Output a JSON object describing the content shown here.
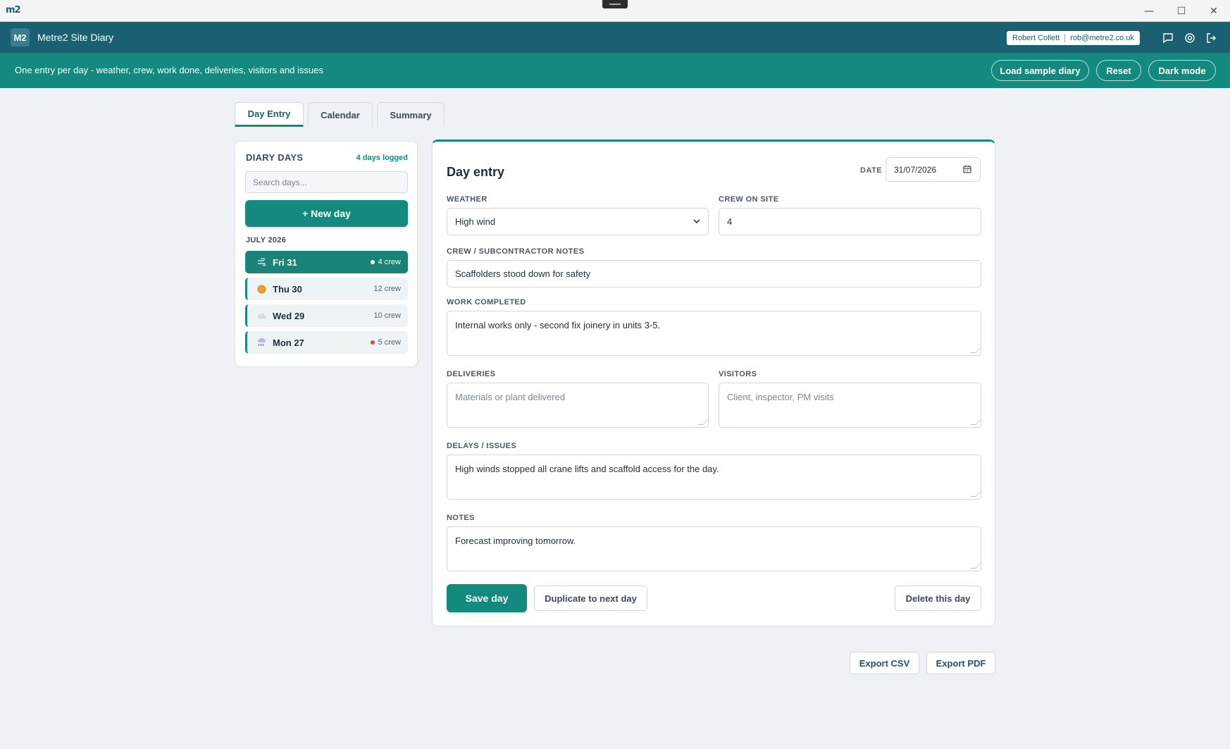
{
  "window": {
    "logo": "m2",
    "minimize_glyph": "—",
    "maximize_glyph": "☐",
    "close_glyph": "✕"
  },
  "header": {
    "badge": "M2",
    "title": "Metre2 Site Diary",
    "user_name": "Robert Collett",
    "user_email": "rob@metre2.co.uk",
    "icons": [
      "chat-icon",
      "gear-icon",
      "logout-icon"
    ]
  },
  "banner": {
    "tagline": "One entry per day - weather, crew, work done, deliveries, visitors and issues",
    "load_sample": "Load sample diary",
    "reset": "Reset",
    "dark_mode": "Dark mode"
  },
  "tabs": [
    {
      "label": "Day Entry",
      "active": true
    },
    {
      "label": "Calendar",
      "active": false
    },
    {
      "label": "Summary",
      "active": false
    }
  ],
  "sidebar": {
    "title": "DIARY DAYS",
    "count": "4 days logged",
    "search_placeholder": "Search days...",
    "new_day": "+ New day",
    "month": "JULY 2026",
    "days": [
      {
        "label": "Fri 31",
        "crew": "4 crew",
        "weather_icon": "wind-icon",
        "dot_color": "#ffffff",
        "active": true
      },
      {
        "label": "Thu 30",
        "crew": "12 crew",
        "weather_icon": "sun-icon",
        "dot_color": "",
        "active": false
      },
      {
        "label": "Wed 29",
        "crew": "10 crew",
        "weather_icon": "cloud-icon",
        "dot_color": "",
        "active": false
      },
      {
        "label": "Mon 27",
        "crew": "5 crew",
        "weather_icon": "rain-icon",
        "dot_color": "#d9463b",
        "active": false
      }
    ]
  },
  "entry": {
    "title": "Day entry",
    "date_label": "DATE",
    "date_value": "31/07/2026",
    "weather_label": "WEATHER",
    "weather_value": "High wind",
    "crew_label": "CREW ON SITE",
    "crew_value": "4",
    "crew_notes_label": "CREW / SUBCONTRACTOR NOTES",
    "crew_notes_value": "Scaffolders stood down for safety",
    "work_label": "WORK COMPLETED",
    "work_value": "Internal works only - second fix joinery in units 3-5.",
    "deliveries_label": "DELIVERIES",
    "deliveries_placeholder": "Materials or plant delivered",
    "visitors_label": "VISITORS",
    "visitors_placeholder": "Client, inspector, PM visits",
    "delays_label": "DELAYS / ISSUES",
    "delays_value": "High winds stopped all crane lifts and scaffold access for the day.",
    "notes_label": "NOTES",
    "notes_value": "Forecast improving tomorrow.",
    "save": "Save day",
    "duplicate": "Duplicate to next day",
    "delete": "Delete this day"
  },
  "export": {
    "csv": "Export CSV",
    "pdf": "Export PDF"
  },
  "colors": {
    "header": "#1a6072",
    "banner": "#148a7e",
    "accent": "#148a7e",
    "background": "#eef2f6"
  }
}
